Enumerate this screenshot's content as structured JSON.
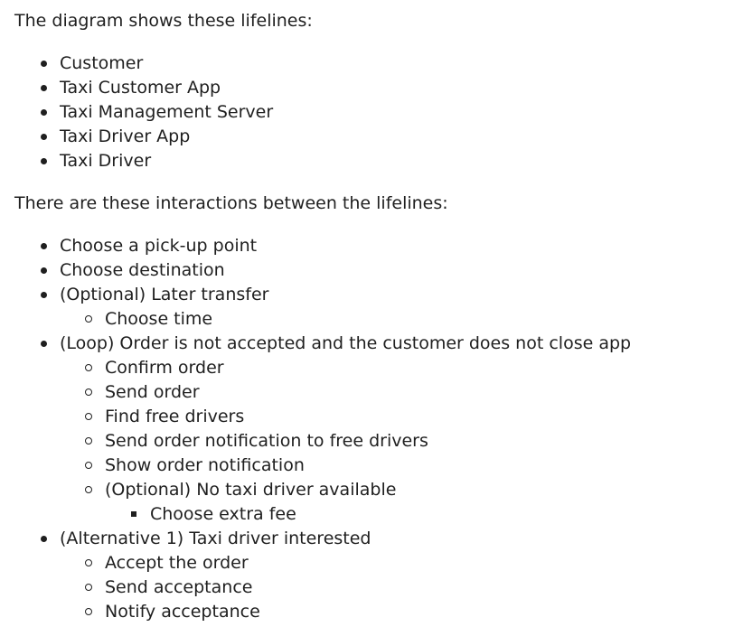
{
  "intro_lifelines": "The diagram shows these lifelines:",
  "lifelines": [
    "Customer",
    "Taxi Customer App",
    "Taxi Management Server",
    "Taxi Driver App",
    "Taxi Driver"
  ],
  "intro_interactions": "There are these interactions between the lifelines:",
  "interactions": [
    {
      "label": "Choose a pick-up point"
    },
    {
      "label": "Choose destination"
    },
    {
      "label": "(Optional) Later transfer",
      "children": [
        {
          "label": "Choose time"
        }
      ]
    },
    {
      "label": "(Loop) Order is not accepted and the customer does not close app",
      "children": [
        {
          "label": "Confirm order"
        },
        {
          "label": "Send order"
        },
        {
          "label": "Find free drivers"
        },
        {
          "label": "Send order notification to free drivers"
        },
        {
          "label": "Show order notification"
        },
        {
          "label": "(Optional) No taxi driver available",
          "children": [
            {
              "label": "Choose extra fee"
            }
          ]
        }
      ]
    },
    {
      "label": "(Alternative 1) Taxi driver interested",
      "children": [
        {
          "label": "Accept the order"
        },
        {
          "label": "Send acceptance"
        },
        {
          "label": "Notify acceptance"
        }
      ]
    }
  ]
}
